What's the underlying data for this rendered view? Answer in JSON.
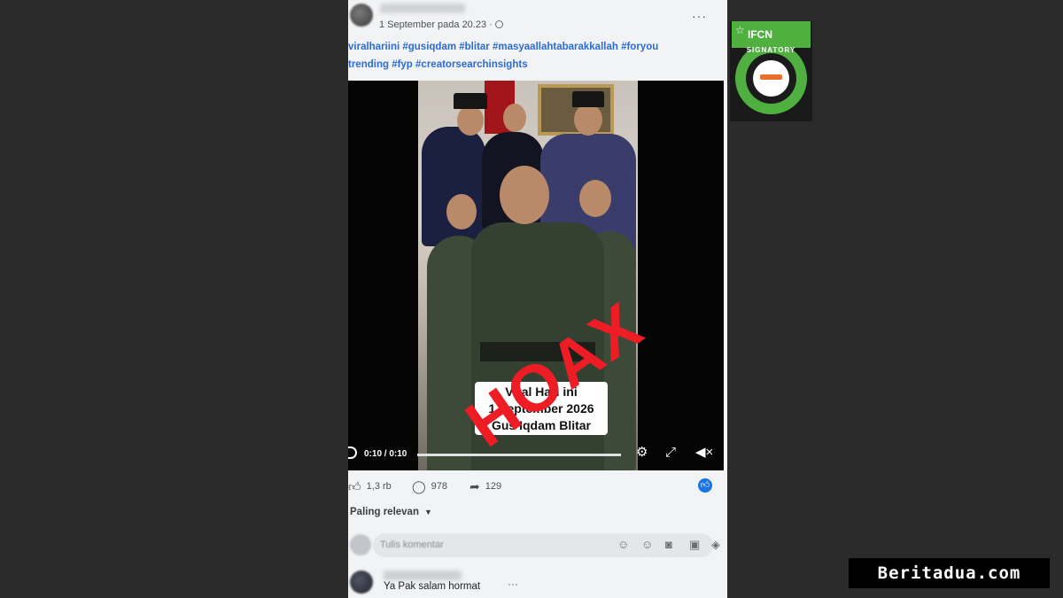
{
  "post": {
    "time": "1 September pada 20.23 ·",
    "more": "···",
    "hashtags_line1": "viralhariini #gusiqdam #blitar #masyaallahtabarakkallah #foryou",
    "hashtags_line2": "trending #fyp #creatorsearchinsights"
  },
  "video": {
    "caption_line1": "Viral Hari ini",
    "caption_line2": "1 September 2026",
    "caption_line3": "Gus Iqdam Blitar",
    "stamp": "HOAX",
    "time": "0:10 / 0:10",
    "progress": 1.0
  },
  "stats": {
    "likes": "1,3 rb",
    "comments": "978",
    "shares": "129"
  },
  "sort": {
    "label": "Paling relevan"
  },
  "comment_box": {
    "placeholder": "Tulis komentar"
  },
  "reply": {
    "text": "Ya Pak salam hormat",
    "more": "···"
  },
  "badge": {
    "logo": "IFCN",
    "ring_text": "SIGNATORY"
  },
  "watermark": {
    "text": "Beritadua.com"
  },
  "colors": {
    "hashtag": "#2d6bd4",
    "stamp": "#ee1c24",
    "ifcn_green": "#4fb040",
    "like_badge": "#1b74e4"
  }
}
